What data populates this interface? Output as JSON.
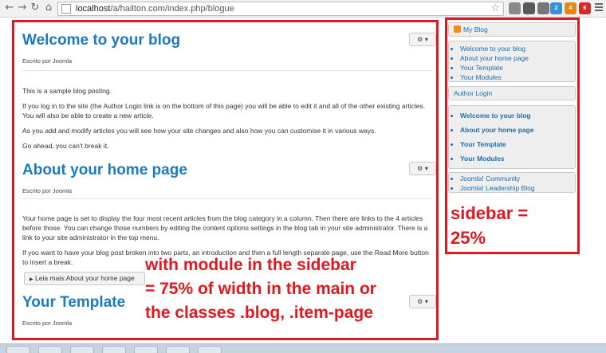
{
  "browser": {
    "url_host": "localhost",
    "url_path": "/a/hailton.com/index.php/blogue",
    "icons": [
      "back-icon",
      "forward-icon",
      "reload-icon",
      "home-icon",
      "star-icon",
      "menu-icon"
    ],
    "badges": [
      "2",
      "4",
      "6"
    ]
  },
  "articles": [
    {
      "title": "Welcome to your blog",
      "byline": "Escrito por Joomla",
      "paragraphs": [
        "This is a sample blog posting.",
        "If you log in to the site (the Author Login link is on the bottom of this page) you will be able to edit it and all of the other existing articles. You will also be able to create a new article.",
        "As you add and modify articles you will see how your site changes and also how you can customise it in various ways.",
        "Go ahead, you can't break it."
      ]
    },
    {
      "title": "About your home page",
      "byline": "Escrito por Joomla",
      "paragraphs": [
        "Your home page is set to display the four most recent articles from the blog category in a column. Then there are links to the 4 articles before those. You can change those numbers by editing the content options settings in the blog tab in your site administrator. There is a link to your site administrator in the top menu.",
        "If you want to have your blog post broken into two parts, an introduction and then a full length separate page, use the Read More button to insert a break."
      ],
      "readmore": "Leia mais:About your home page"
    },
    {
      "title": "Your Template",
      "byline": "Escrito por Joomla"
    }
  ],
  "gear_label": "⚙ ▾",
  "readmore_icon": "▶",
  "sidebar": {
    "my_blog": {
      "title": "My Blog",
      "items": [
        "Welcome to your blog",
        "About your home page",
        "Your Template",
        "Your Modules"
      ]
    },
    "author_login": {
      "title": "Author Login",
      "items": [
        "Welcome to your blog",
        "About your home page",
        "Your Template",
        "Your Modules"
      ]
    },
    "links": {
      "items": [
        "Joomla! Community",
        "Joomla! Leadership Blog"
      ]
    }
  },
  "annotations": {
    "sidebar_line1": "sidebar =",
    "sidebar_line2": "25%",
    "main_line1": "with module in the sidebar",
    "main_line2": "= 75% of width in the main or",
    "main_line3": "the classes .blog, .item-page"
  },
  "colors": {
    "annotation_red": "#e0181f",
    "link_blue": "#1a7bc0",
    "module_bg": "#eeeeee"
  }
}
